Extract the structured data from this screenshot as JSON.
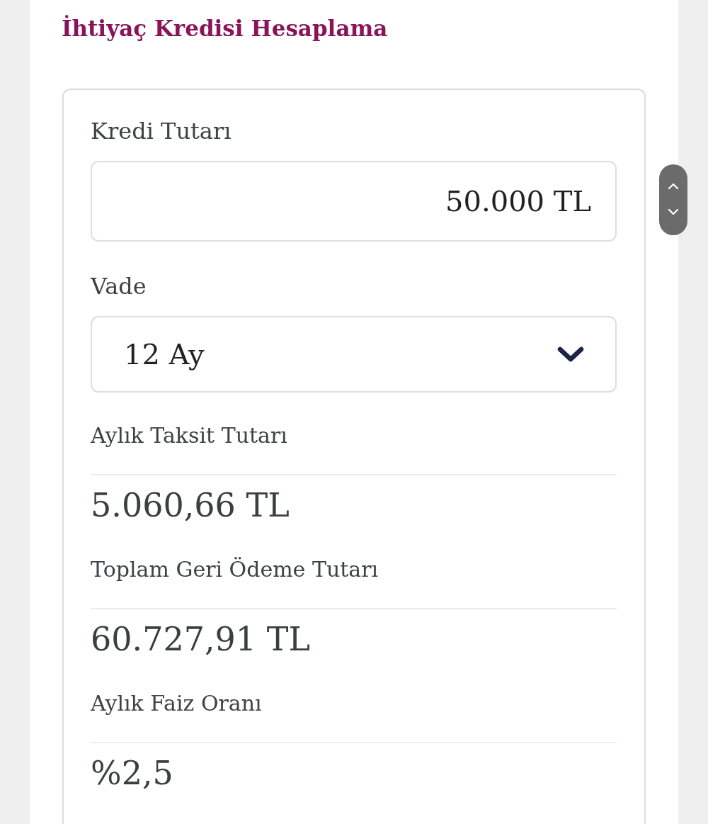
{
  "title": "İhtiyaç Kredisi Hesaplama",
  "form": {
    "amount": {
      "label": "Kredi Tutarı",
      "value": "50.000 TL"
    },
    "term": {
      "label": "Vade",
      "value": "12 Ay"
    }
  },
  "results": [
    {
      "label": "Aylık Taksit Tutarı",
      "value": "5.060,66 TL"
    },
    {
      "label": "Toplam Geri Ödeme Tutarı",
      "value": "60.727,91 TL"
    },
    {
      "label": "Aylık Faiz Oranı",
      "value": "%2,5"
    }
  ]
}
